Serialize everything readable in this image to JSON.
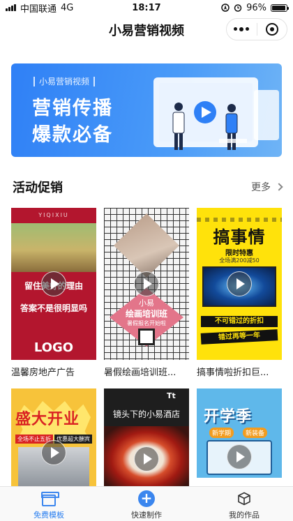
{
  "status_bar": {
    "carrier": "中国联通",
    "network": "4G",
    "time": "18:17",
    "battery": "96%",
    "battery_level": 0.96
  },
  "nav": {
    "title": "小易营销视频"
  },
  "banner": {
    "tag": "小易营销视频",
    "line1": "营销传播",
    "line2": "爆款必备"
  },
  "section": {
    "title": "活动促销",
    "more": "更多"
  },
  "cards": [
    {
      "label": "温馨房地产广告",
      "en_text": "YIQIXIU",
      "text1": "留住美好的理由",
      "text2": "答案不是很明显吗",
      "logo": "LOGO"
    },
    {
      "label": "暑假绘画培训班...",
      "text1": "小易",
      "text2": "绘画培训班",
      "text3": "暑假报名开始啦"
    },
    {
      "label": "搞事情啦折扣巨...",
      "big": "搞事情",
      "limit": "限时特惠",
      "sub": "全场满200减50",
      "stamp1": "不可错过的折扣",
      "stamp2": "错过再等一年"
    },
    {
      "title": "盛大开业",
      "tag1": "全场不止五折",
      "tag2": "优惠超大酬宾"
    },
    {
      "title": "镜头下的小易酒店",
      "logo": "Tt"
    },
    {
      "title": "开学季",
      "pill1": "新学期",
      "pill2": "新装备"
    }
  ],
  "tabbar": {
    "items": [
      {
        "label": "免费模板",
        "icon": "template-shop-icon",
        "active": true
      },
      {
        "label": "快速制作",
        "icon": "plus-circle-icon",
        "active": false
      },
      {
        "label": "我的作品",
        "icon": "cube-icon",
        "active": false
      }
    ]
  },
  "colors": {
    "accent": "#2a7ff0",
    "banner": "#3a8bf7"
  }
}
